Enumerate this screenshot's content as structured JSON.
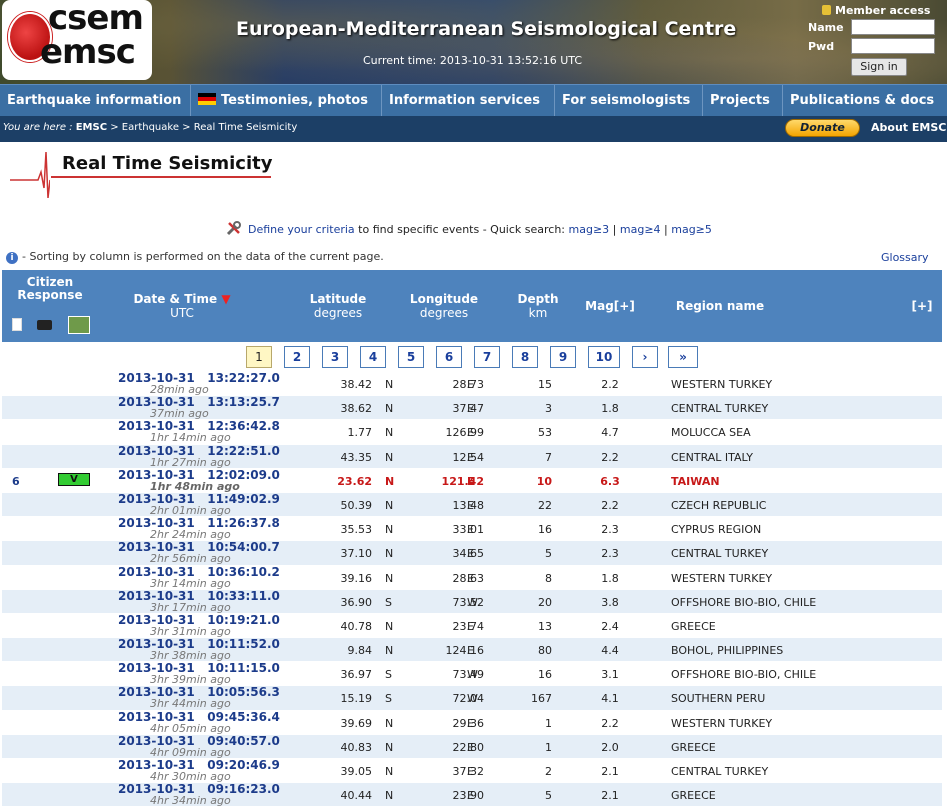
{
  "header": {
    "logo_line1": "csem",
    "logo_line2": "emsc",
    "site_title": "European-Mediterranean Seismological Centre",
    "current_time": "Current time: 2013-10-31 13:52:16 UTC",
    "member_access": "Member access",
    "name_label": "Name",
    "pwd_label": "Pwd",
    "sign_in": "Sign in"
  },
  "nav": {
    "items": [
      "Earthquake information",
      "Testimonies, photos",
      "Information services",
      "For seismologists",
      "Projects",
      "Publications & docs"
    ]
  },
  "breadcrumb": {
    "prefix": "You are here : ",
    "root": "EMSC",
    "path": " > Earthquake > Real Time Seismicity",
    "donate": "Donate",
    "about": "About EMSC"
  },
  "page": {
    "title": "Real Time Seismicity",
    "criteria_link": "Define your criteria",
    "criteria_text": " to find specific events - Quick search: ",
    "quick": [
      "mag≥3",
      "mag≥4",
      "mag≥5"
    ],
    "sort_info": "- Sorting by column is performed on the data of the current page.",
    "glossary": "Glossary"
  },
  "table": {
    "headers": {
      "citizen": "Citizen Response",
      "datetime": "Date & Time",
      "datetime_sub": "UTC",
      "lat": "Latitude",
      "lat_sub": "degrees",
      "lon": "Longitude",
      "lon_sub": "degrees",
      "depth": "Depth",
      "depth_sub": "km",
      "mag": "Mag[+]",
      "region": "Region name",
      "more": "[+]"
    },
    "pages": [
      "1",
      "2",
      "3",
      "4",
      "5",
      "6",
      "7",
      "8",
      "9",
      "10",
      "›",
      "»"
    ],
    "rows": [
      {
        "dt": "2013-10-31   13:22:27.0",
        "ago": "28min ago",
        "lat": "38.42",
        "ns": "N",
        "lon": "28.73",
        "ew": "E",
        "depth": "15",
        "mag": "2.2",
        "region": "WESTERN TURKEY"
      },
      {
        "dt": "2013-10-31   13:13:25.7",
        "ago": "37min ago",
        "lat": "38.62",
        "ns": "N",
        "lon": "37.47",
        "ew": "E",
        "depth": "3",
        "mag": "1.8",
        "region": "CENTRAL TURKEY"
      },
      {
        "dt": "2013-10-31   12:36:42.8",
        "ago": "1hr 14min ago",
        "lat": "1.77",
        "ns": "N",
        "lon": "126.99",
        "ew": "E",
        "depth": "53",
        "mag": "4.7",
        "region": "MOLUCCA SEA"
      },
      {
        "dt": "2013-10-31   12:22:51.0",
        "ago": "1hr 27min ago",
        "lat": "43.35",
        "ns": "N",
        "lon": "12.54",
        "ew": "E",
        "depth": "7",
        "mag": "2.2",
        "region": "CENTRAL ITALY"
      },
      {
        "dt": "2013-10-31   12:02:09.0",
        "ago": "1hr 48min ago",
        "lat": "23.62",
        "ns": "N",
        "lon": "121.42",
        "ew": "E",
        "depth": "10",
        "mag": "6.3",
        "region": "TAIWAN",
        "citizen_count": "6",
        "citizen_badge": "V"
      },
      {
        "dt": "2013-10-31   11:49:02.9",
        "ago": "2hr 01min ago",
        "lat": "50.39",
        "ns": "N",
        "lon": "13.48",
        "ew": "E",
        "depth": "22",
        "mag": "2.2",
        "region": "CZECH REPUBLIC"
      },
      {
        "dt": "2013-10-31   11:26:37.8",
        "ago": "2hr 24min ago",
        "lat": "35.53",
        "ns": "N",
        "lon": "33.01",
        "ew": "E",
        "depth": "16",
        "mag": "2.3",
        "region": "CYPRUS REGION"
      },
      {
        "dt": "2013-10-31   10:54:00.7",
        "ago": "2hr 56min ago",
        "lat": "37.10",
        "ns": "N",
        "lon": "34.65",
        "ew": "E",
        "depth": "5",
        "mag": "2.3",
        "region": "CENTRAL TURKEY"
      },
      {
        "dt": "2013-10-31   10:36:10.2",
        "ago": "3hr 14min ago",
        "lat": "39.16",
        "ns": "N",
        "lon": "28.63",
        "ew": "E",
        "depth": "8",
        "mag": "1.8",
        "region": "WESTERN TURKEY"
      },
      {
        "dt": "2013-10-31   10:33:11.0",
        "ago": "3hr 17min ago",
        "lat": "36.90",
        "ns": "S",
        "lon": "73.52",
        "ew": "W",
        "depth": "20",
        "mag": "3.8",
        "region": "OFFSHORE BIO-BIO, CHILE"
      },
      {
        "dt": "2013-10-31   10:19:21.0",
        "ago": "3hr 31min ago",
        "lat": "40.78",
        "ns": "N",
        "lon": "23.74",
        "ew": "E",
        "depth": "13",
        "mag": "2.4",
        "region": "GREECE"
      },
      {
        "dt": "2013-10-31   10:11:52.0",
        "ago": "3hr 38min ago",
        "lat": "9.84",
        "ns": "N",
        "lon": "124.16",
        "ew": "E",
        "depth": "80",
        "mag": "4.4",
        "region": "BOHOL, PHILIPPINES"
      },
      {
        "dt": "2013-10-31   10:11:15.0",
        "ago": "3hr 39min ago",
        "lat": "36.97",
        "ns": "S",
        "lon": "73.49",
        "ew": "W",
        "depth": "16",
        "mag": "3.1",
        "region": "OFFSHORE BIO-BIO, CHILE"
      },
      {
        "dt": "2013-10-31   10:05:56.3",
        "ago": "3hr 44min ago",
        "lat": "15.19",
        "ns": "S",
        "lon": "72.04",
        "ew": "W",
        "depth": "167",
        "mag": "4.1",
        "region": "SOUTHERN PERU"
      },
      {
        "dt": "2013-10-31   09:45:36.4",
        "ago": "4hr 05min ago",
        "lat": "39.69",
        "ns": "N",
        "lon": "29.36",
        "ew": "E",
        "depth": "1",
        "mag": "2.2",
        "region": "WESTERN TURKEY"
      },
      {
        "dt": "2013-10-31   09:40:57.0",
        "ago": "4hr 09min ago",
        "lat": "40.83",
        "ns": "N",
        "lon": "22.80",
        "ew": "E",
        "depth": "1",
        "mag": "2.0",
        "region": "GREECE"
      },
      {
        "dt": "2013-10-31   09:20:46.9",
        "ago": "4hr 30min ago",
        "lat": "39.05",
        "ns": "N",
        "lon": "37.32",
        "ew": "E",
        "depth": "2",
        "mag": "2.1",
        "region": "CENTRAL TURKEY"
      },
      {
        "dt": "2013-10-31   09:16:23.0",
        "ago": "4hr 34min ago",
        "lat": "40.44",
        "ns": "N",
        "lon": "23.90",
        "ew": "E",
        "depth": "5",
        "mag": "2.1",
        "region": "GREECE"
      }
    ]
  }
}
